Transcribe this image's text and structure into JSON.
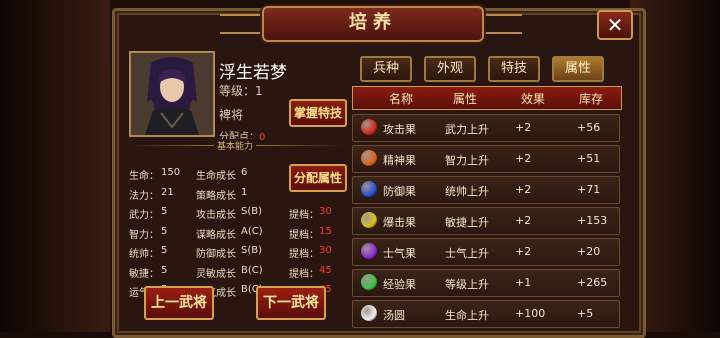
{
  "title": "培养",
  "close_label": "✕",
  "hero": {
    "name": "浮生若梦",
    "level_label": "等级：1",
    "rank": "裨将",
    "points_label": "分配点：",
    "points_value": "0",
    "master_skill_button": "掌握特技",
    "assign_attr_button": "分配属性",
    "section_label": "基本能力"
  },
  "stats": [
    {
      "k1": "生命：",
      "v1": "150",
      "k2": "生命成长",
      "v2": "6",
      "k3": "",
      "v3": ""
    },
    {
      "k1": "法力：",
      "v1": "21",
      "k2": "策略成长",
      "v2": "1",
      "k3": "",
      "v3": ""
    },
    {
      "k1": "武力：",
      "v1": "5",
      "k2": "攻击成长",
      "v2": "S(B)",
      "k3": "提档：",
      "v3": "30"
    },
    {
      "k1": "智力：",
      "v1": "5",
      "k2": "谋略成长",
      "v2": "A(C)",
      "k3": "提档：",
      "v3": "15"
    },
    {
      "k1": "统帅：",
      "v1": "5",
      "k2": "防御成长",
      "v2": "S(B)",
      "k3": "提档：",
      "v3": "30"
    },
    {
      "k1": "敏捷：",
      "v1": "5",
      "k2": "灵敏成长",
      "v2": "B(C)",
      "k3": "提档：",
      "v3": "45"
    },
    {
      "k1": "运气：",
      "v1": "5",
      "k2": "士气成长",
      "v2": "B(C)",
      "k3": "提档：",
      "v3": "45"
    }
  ],
  "nav": {
    "prev": "上一武将",
    "next": "下一武将"
  },
  "tabs": [
    "兵种",
    "外观",
    "特技",
    "属性"
  ],
  "active_tab": "属性",
  "table": {
    "headers": [
      "名称",
      "属性",
      "效果",
      "库存"
    ],
    "rows": [
      {
        "name": "攻击果",
        "attr": "武力上升",
        "effect": "+2",
        "stock": "+56",
        "icon": "red-fruit-icon",
        "color": "#d42a1a"
      },
      {
        "name": "精神果",
        "attr": "智力上升",
        "effect": "+2",
        "stock": "+51",
        "icon": "orange-fruit-icon",
        "color": "#e0621c"
      },
      {
        "name": "防御果",
        "attr": "统帅上升",
        "effect": "+2",
        "stock": "+71",
        "icon": "blue-fruit-icon",
        "color": "#2a4ad8"
      },
      {
        "name": "爆击果",
        "attr": "敏捷上升",
        "effect": "+2",
        "stock": "+153",
        "icon": "yellow-fruit-icon",
        "color": "#d8c21a"
      },
      {
        "name": "士气果",
        "attr": "士气上升",
        "effect": "+2",
        "stock": "+20",
        "icon": "purple-fruit-icon",
        "color": "#8a2ad8"
      },
      {
        "name": "经验果",
        "attr": "等级上升",
        "effect": "+1",
        "stock": "+265",
        "icon": "green-fruit-icon",
        "color": "#3ac24a"
      },
      {
        "name": "汤圆",
        "attr": "生命上升",
        "effect": "+100",
        "stock": "+5",
        "icon": "dumpling-icon",
        "color": "#f0f0f0"
      }
    ]
  }
}
